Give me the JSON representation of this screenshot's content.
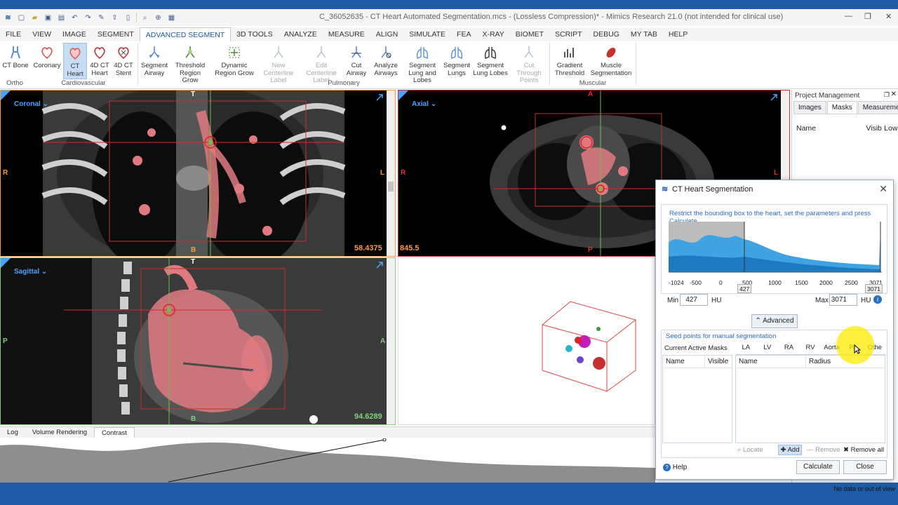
{
  "window": {
    "title": "C_36052635 - CT Heart Automated Segmentation.mcs -  (Lossless Compression)* - Mimics Research 21.0 (not intended for clinical use)"
  },
  "menu": [
    "FILE",
    "VIEW",
    "IMAGE",
    "SEGMENT",
    "ADVANCED SEGMENT",
    "3D TOOLS",
    "ANALYZE",
    "MEASURE",
    "ALIGN",
    "SIMULATE",
    "FEA",
    "X-RAY",
    "BIOMET",
    "SCRIPT",
    "DEBUG",
    "MY TAB",
    "HELP"
  ],
  "menu_active": "ADVANCED SEGMENT",
  "ribbon": {
    "groups": [
      "Ortho",
      "Cardiovascular",
      "Pulmonary",
      "Muscular"
    ],
    "buttons": {
      "ct_bone": "CT Bone",
      "coronary": "Coronary",
      "ct_heart": "CT Heart",
      "ct_heart_4d": "4D CT Heart",
      "ct_stent_4d": "4D CT Stent",
      "segment_airway": "Segment Airway",
      "threshold_region_grow": "Threshold Region Grow",
      "dynamic_region_grow": "Dynamic Region Grow",
      "new_centerline_label": "New Centerline Label",
      "edit_centerline_label": "Edit Centerline Label",
      "cut_airway": "Cut Airway",
      "analyze_airways": "Analyze Airways",
      "segment_lung_lobes": "Segment Lung and Lobes",
      "segment_lungs": "Segment Lungs",
      "segment_lung_lobes2": "Segment Lung Lobes",
      "cut_through_points": "Cut Through Points",
      "gradient_threshold": "Gradient Threshold",
      "muscle_segmentation": "Muscle Segmentation"
    }
  },
  "views": {
    "coronal": {
      "label": "Coronal",
      "value": "58.4375",
      "top": "T",
      "bottom": "B",
      "left": "R",
      "right": "L"
    },
    "axial": {
      "label": "Axial",
      "value": "845.5",
      "top": "A",
      "bottom": "P",
      "left": "R",
      "right": "L"
    },
    "sagittal": {
      "label": "Sagittal",
      "value": "94.6289",
      "top": "T",
      "bottom": "B",
      "left": "P",
      "right": "A"
    }
  },
  "bottom_tabs": [
    "Log",
    "Volume Rendering",
    "Contrast"
  ],
  "bottom_tab_active": "Contrast",
  "project": {
    "title": "Project Management",
    "tabs": [
      "Images",
      "Masks",
      "Measurements"
    ],
    "active_tab": "Masks",
    "columns": [
      "Name",
      "Visib",
      "Low"
    ]
  },
  "dialog": {
    "title": "CT Heart Segmentation",
    "instruction": "Restrict the bounding box to the heart, set the parameters and press Calculate",
    "histogram_ticks": [
      "-1024",
      "-500",
      "0",
      "500",
      "1000",
      "1500",
      "2000",
      "2500",
      "3071"
    ],
    "marker_min": "427",
    "marker_max": "3071",
    "min_label": "Min",
    "min_value": "427",
    "max_label": "Max",
    "max_value": "3071",
    "unit": "HU",
    "advanced": "Advanced",
    "seed_header": "Seed points for manual segmentation",
    "active_masks": "Current Active Masks",
    "mask_columns": [
      "Name",
      "Visible"
    ],
    "seed_tabs": [
      "LA",
      "LV",
      "RA",
      "RV",
      "Aorta",
      "PA",
      "Othe"
    ],
    "seed_columns": [
      "Name",
      "Radius"
    ],
    "locate": "Locate",
    "add": "Add",
    "remove": "Remove",
    "remove_all": "Remove all",
    "help": "Help",
    "calculate": "Calculate",
    "close": "Close"
  },
  "status": {
    "text": "No data or out of view"
  },
  "colors": {
    "accent": "#1e5aa6",
    "view_label": "#4aa3ff",
    "mask": "#e07a80"
  }
}
